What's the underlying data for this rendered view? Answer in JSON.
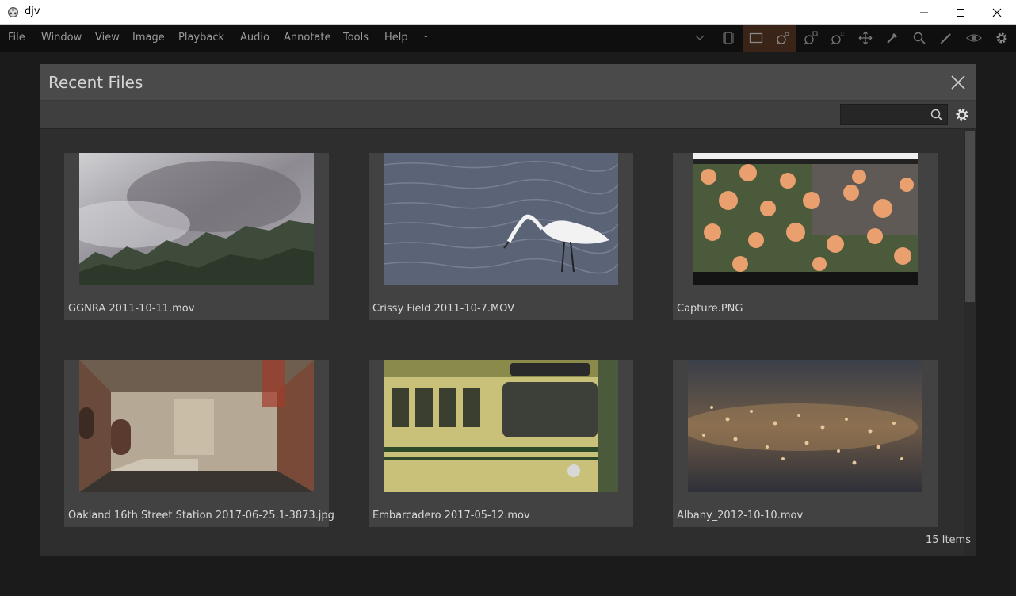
{
  "window": {
    "title": "djv"
  },
  "menu": {
    "items": [
      "File",
      "Window",
      "View",
      "Image",
      "Playback",
      "Audio",
      "Annotate",
      "Tools",
      "Help"
    ],
    "file_combo": "-"
  },
  "dialog": {
    "title": "Recent Files",
    "search_value": "",
    "count_label": "15 Items"
  },
  "files": [
    {
      "name": "GGNRA 2011-10-11.mov"
    },
    {
      "name": "Crissy Field 2011-10-7.MOV"
    },
    {
      "name": "Capture.PNG"
    },
    {
      "name": "Oakland 16th Street Station 2017-06-25.1-3873.jpg"
    },
    {
      "name": "Embarcadero 2017-05-12.mov"
    },
    {
      "name": "Albany_2012-10-10.mov"
    }
  ],
  "toolbar_icons": [
    "frame-icon",
    "fill-icon",
    "zoom-fit-icon",
    "zoom-in-icon",
    "zoom-reset-icon",
    "move-icon",
    "eyedropper-icon",
    "magnify-icon",
    "pen-icon",
    "eye-icon",
    "gear-icon"
  ],
  "colors": {
    "accent_active": "#3a2418",
    "dialog_bg": "#2e2e2e",
    "card_bg": "#424242"
  }
}
